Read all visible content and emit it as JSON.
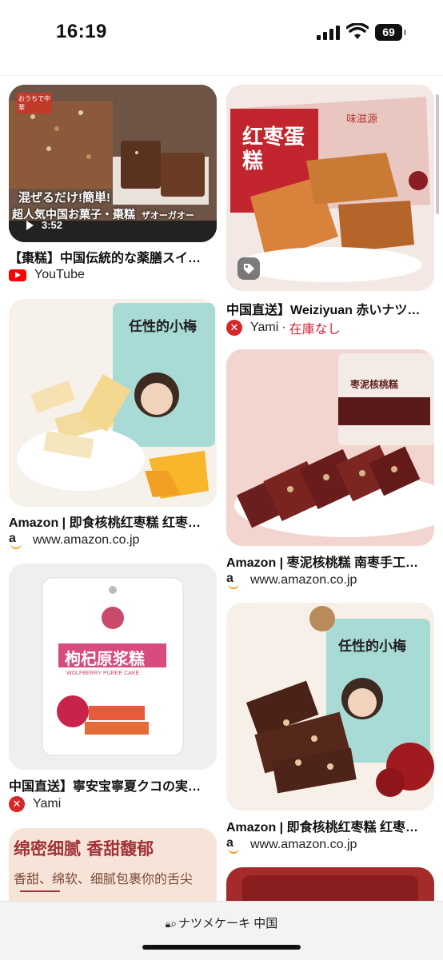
{
  "status_bar": {
    "time": "16:19",
    "battery": "69"
  },
  "results_left": [
    {
      "title": "【棗糕】中国伝統的な薬膳スイ…",
      "source": "YouTube",
      "source_icon": "youtube-icon",
      "thumb": {
        "overlay_line1": "混ぜるだけ!簡単!",
        "overlay_line2": "超人気中国お菓子・棗糕",
        "overlay_line3": "ザオーガオー",
        "duration": "3:52",
        "corner_label": "おうちで中華"
      }
    },
    {
      "title": "Amazon | 即食核桃红枣糕 红枣…",
      "source": "www.amazon.co.jp",
      "source_icon": "amazon-icon",
      "thumb": {
        "package_text": "任性的小梅"
      }
    },
    {
      "title": "中国直送】寧安宝寧夏クコの実…",
      "source": "Yami",
      "source_icon": "yami-icon",
      "thumb": {
        "package_text": "枸杞原浆糕",
        "package_sub": "WOLFBERRY PUREE CAKE"
      }
    },
    {
      "title": "",
      "source": "",
      "thumb": {
        "headline": "绵密细腻 香甜馥郁",
        "subline": "香甜、绵软、细腻包裹你的舌尖"
      }
    }
  ],
  "results_right": [
    {
      "title": "中国直送】Weiziyuan 赤いナツ…",
      "source": "Yami",
      "source_extra": "在庫なし",
      "source_icon": "yami-icon",
      "thumb": {
        "box_text": "红枣蛋糕",
        "brand": "味滋源"
      }
    },
    {
      "title": "Amazon | 枣泥核桃糕 南枣手工…",
      "source": "www.amazon.co.jp",
      "source_icon": "amazon-icon",
      "thumb": {
        "package_text": "枣泥核桃糕"
      }
    },
    {
      "title": "Amazon | 即食核桃红枣糕 红枣…",
      "source": "www.amazon.co.jp",
      "source_icon": "amazon-icon",
      "thumb": {
        "package_text": "任性的小梅"
      }
    }
  ],
  "address_bar": {
    "query": "ナツメケーキ 中国"
  },
  "colors": {
    "yami_red": "#d62828",
    "youtube_red": "#ff0000",
    "amazon_orange": "#f49a1a"
  }
}
